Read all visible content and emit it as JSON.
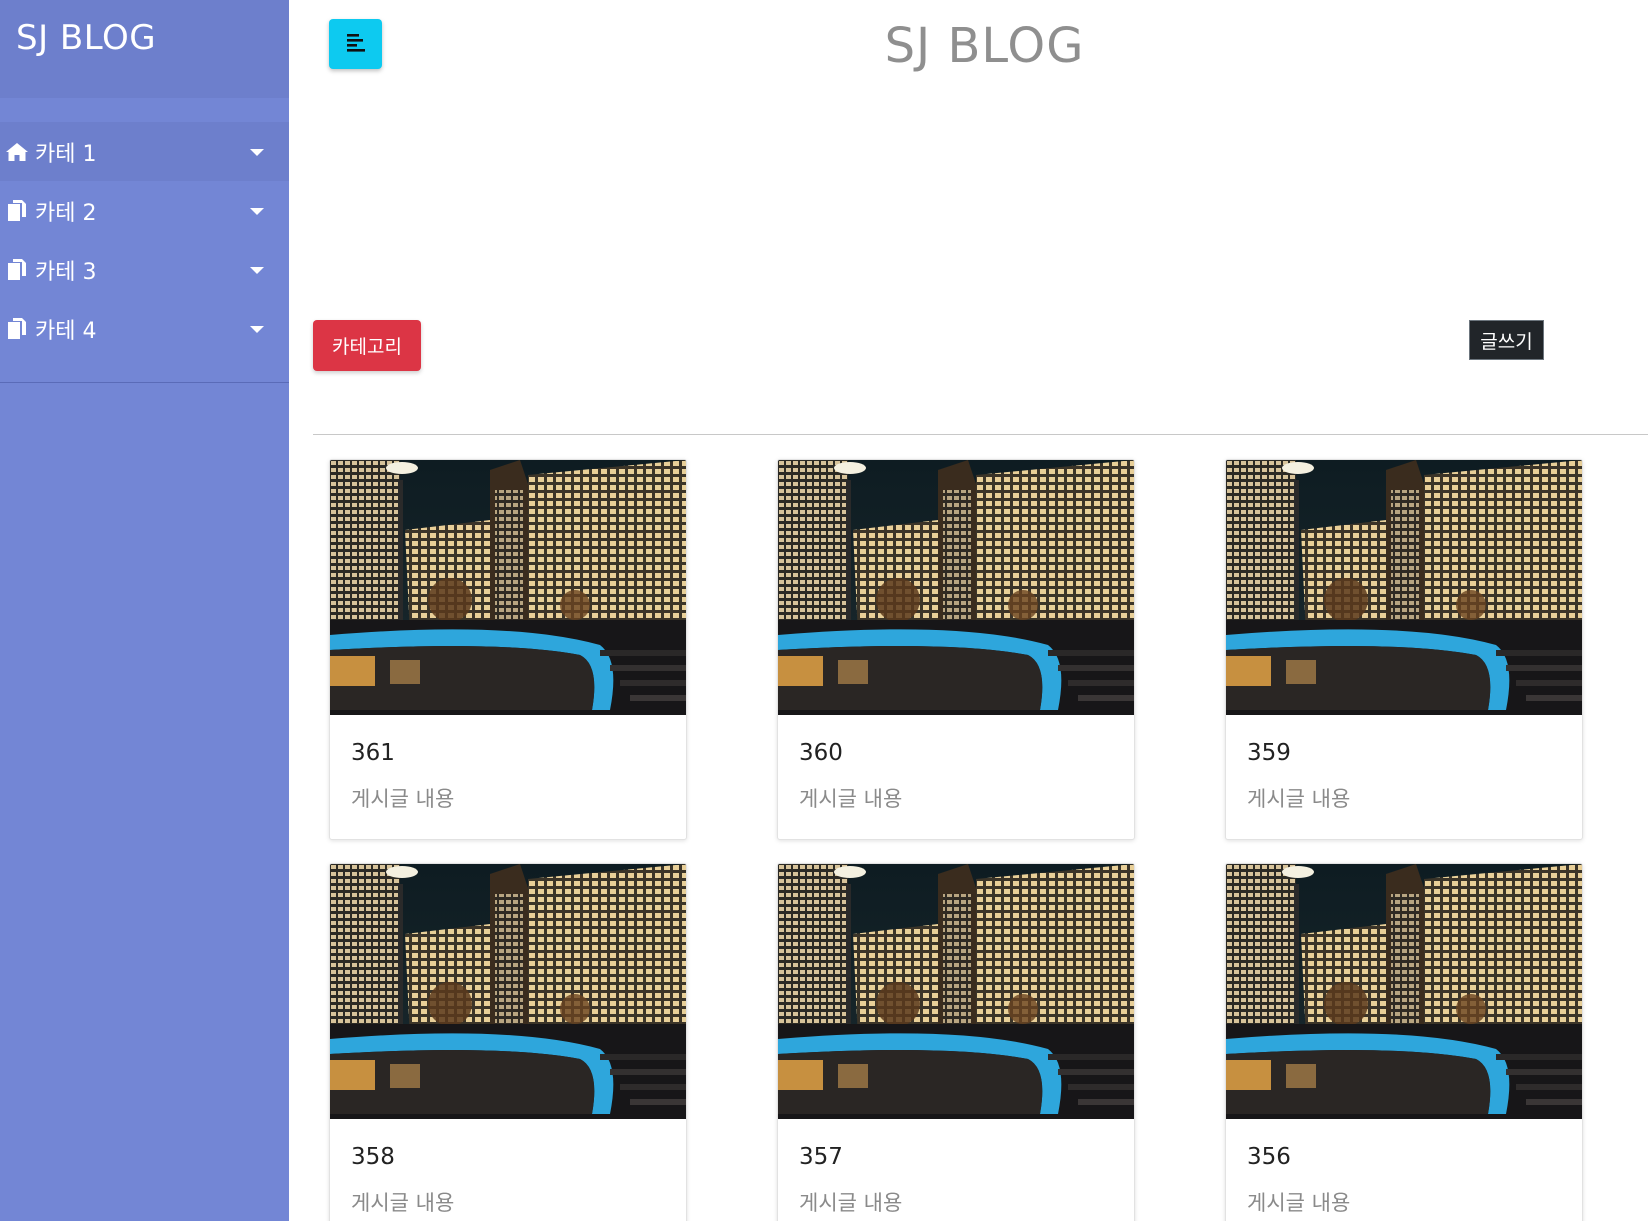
{
  "sidebar": {
    "title": "SJ BLOG",
    "items": [
      {
        "label": "카테 1",
        "icon": "home-icon"
      },
      {
        "label": "카테 2",
        "icon": "copy-icon"
      },
      {
        "label": "카테 3",
        "icon": "copy-icon"
      },
      {
        "label": "카테 4",
        "icon": "copy-icon"
      }
    ]
  },
  "header": {
    "title": "SJ BLOG",
    "toggle_icon": "align-left-icon"
  },
  "toolbar": {
    "category_label": "카테고리",
    "write_label": "글쓰기"
  },
  "posts": [
    {
      "title": "361",
      "text": "게시글 내용"
    },
    {
      "title": "360",
      "text": "게시글 내용"
    },
    {
      "title": "359",
      "text": "게시글 내용"
    },
    {
      "title": "358",
      "text": "게시글 내용"
    },
    {
      "title": "357",
      "text": "게시글 내용"
    },
    {
      "title": "356",
      "text": "게시글 내용"
    }
  ],
  "colors": {
    "sidebar": "#7386d5",
    "sidebar_header": "#6d7fcc",
    "toggle": "#0dcaf0",
    "category_button": "#dc3545",
    "write_button": "#212529"
  }
}
